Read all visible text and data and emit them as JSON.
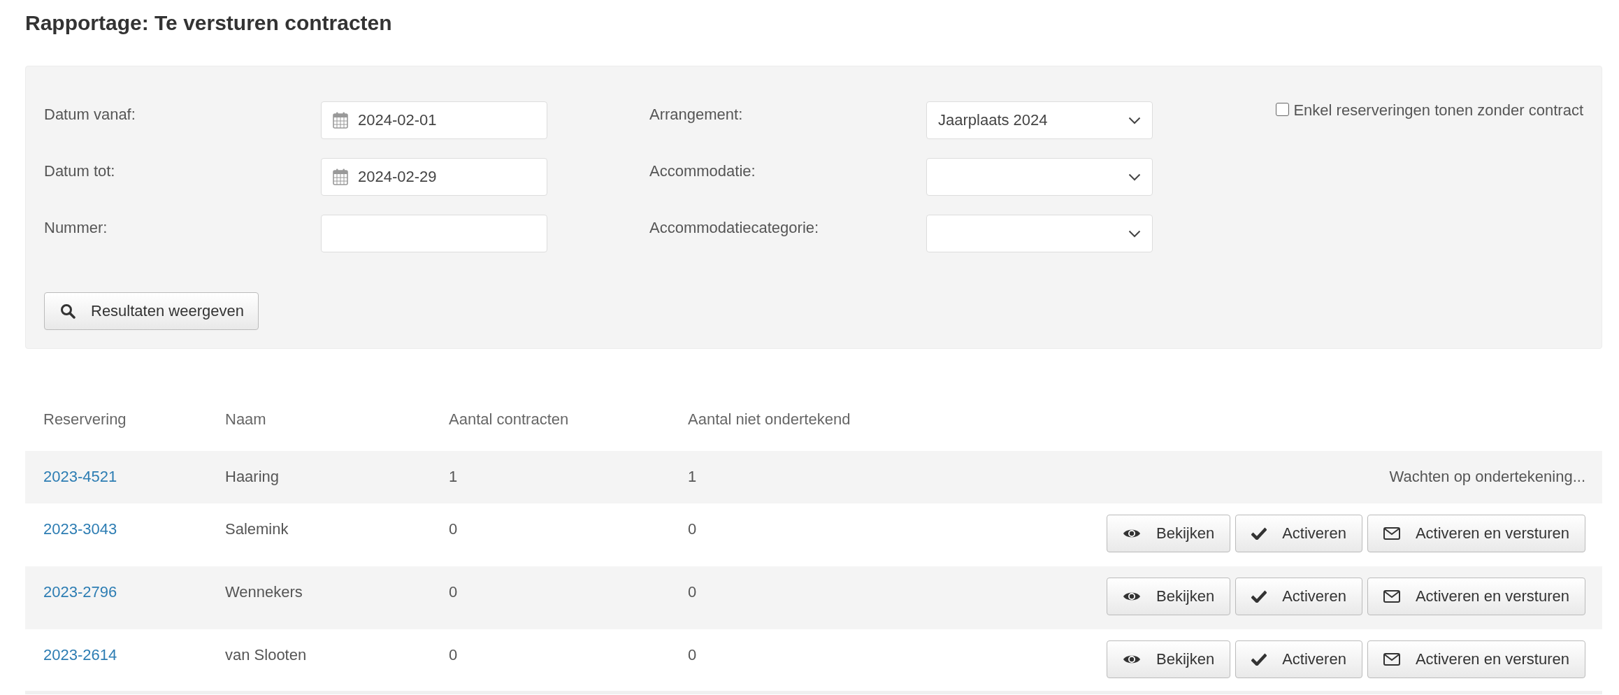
{
  "title": "Rapportage: Te versturen contracten",
  "filters": {
    "fields": [
      {
        "label": "Datum vanaf:",
        "kind": "date",
        "value": "2024-02-01"
      },
      {
        "label": "Datum tot:",
        "kind": "date",
        "value": "2024-02-29"
      },
      {
        "label": "Nummer:",
        "kind": "text"
      }
    ],
    "selects": [
      {
        "label": "Arrangement:",
        "value": "Jaarplaats 2024"
      },
      {
        "label": "Accommodatie:"
      },
      {
        "label": "Accommodatiecategorie:"
      }
    ],
    "checkbox": {
      "label": "Enkel reserveringen tonen zonder contract",
      "checked": false
    },
    "submit": "Resultaten weergeven"
  },
  "table": {
    "columns": [
      "Reservering",
      "Naam",
      "Aantal contracten",
      "Aantal niet ondertekend"
    ],
    "rows": [
      {
        "reservering": "2023-4521",
        "naam": "Haaring",
        "aantal": "1",
        "niet_ondertekend": "1",
        "status": "Wachten op ondertekening..."
      },
      {
        "reservering": "2023-3043",
        "naam": "Salemink",
        "aantal": "0",
        "niet_ondertekend": "0",
        "actions": [
          {
            "kind": "view",
            "label": "Bekijken"
          },
          {
            "kind": "activate",
            "label": "Activeren"
          },
          {
            "kind": "send",
            "label": "Activeren en versturen"
          }
        ]
      },
      {
        "reservering": "2023-2796",
        "naam": "Wennekers",
        "aantal": "0",
        "niet_ondertekend": "0",
        "actions": [
          {
            "kind": "view",
            "label": "Bekijken"
          },
          {
            "kind": "activate",
            "label": "Activeren"
          },
          {
            "kind": "send",
            "label": "Activeren en versturen"
          }
        ]
      },
      {
        "reservering": "2023-2614",
        "naam": "van Slooten",
        "aantal": "0",
        "niet_ondertekend": "0",
        "actions": [
          {
            "kind": "view",
            "label": "Bekijken"
          },
          {
            "kind": "activate",
            "label": "Activeren"
          },
          {
            "kind": "send",
            "label": "Activeren en versturen"
          }
        ]
      }
    ]
  }
}
